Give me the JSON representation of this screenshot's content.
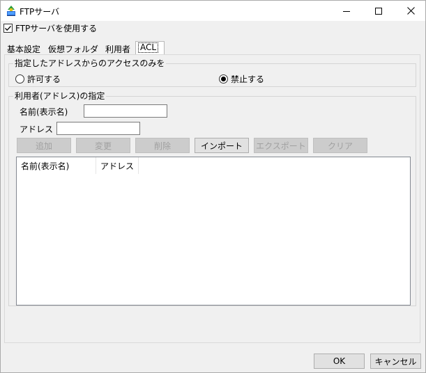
{
  "window": {
    "title": "FTPサーバ",
    "icon": "app-icon",
    "controls": [
      "minimize-icon",
      "maximize-icon",
      "close-icon"
    ]
  },
  "enable": {
    "label": "FTPサーバを使用する",
    "checked": true
  },
  "tabs": [
    {
      "label": "基本設定",
      "active": false
    },
    {
      "label": "仮想フォルダ",
      "active": false
    },
    {
      "label": "利用者",
      "active": false
    },
    {
      "label": "ACL",
      "active": true
    }
  ],
  "access_group": {
    "title": "指定したアドレスからのアクセスのみを",
    "options": [
      {
        "label": "許可する",
        "selected": false
      },
      {
        "label": "禁止する",
        "selected": true
      }
    ]
  },
  "user_group": {
    "title": "利用者(アドレス)の指定",
    "name_label": "名前(表示名)",
    "name_value": "",
    "address_label": "アドレス",
    "address_value": "",
    "buttons": {
      "add": "追加",
      "change": "変更",
      "delete": "削除",
      "import": "インポート",
      "export": "エクスポート",
      "clear": "クリア"
    },
    "list_columns": [
      "名前(表示名)",
      "アドレス"
    ],
    "rows": []
  },
  "footer": {
    "ok": "OK",
    "cancel": "キャンセル"
  }
}
